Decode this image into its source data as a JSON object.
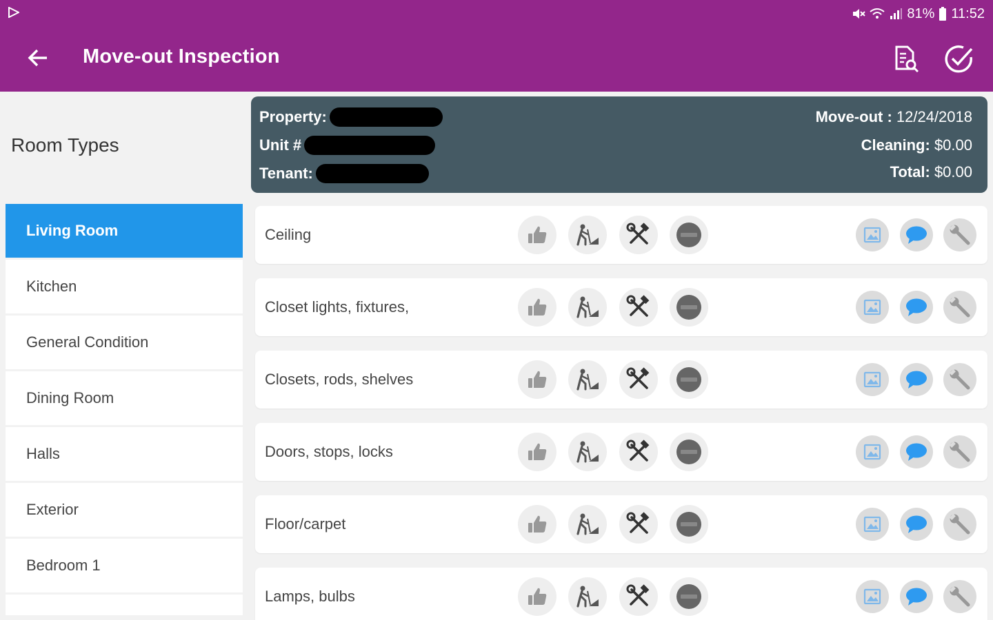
{
  "statusbar": {
    "battery": "81%",
    "time": "11:52"
  },
  "toolbar": {
    "title": "Move-out Inspection"
  },
  "sidebar": {
    "heading": "Room Types",
    "rooms": [
      "Living Room",
      "Kitchen",
      "General Condition",
      "Dining Room",
      "Halls",
      "Exterior",
      "Bedroom 1"
    ],
    "active_index": 0
  },
  "header": {
    "property_label": "Property:",
    "unit_label": "Unit #",
    "tenant_label": "Tenant:",
    "moveout_label": "Move-out :",
    "moveout_value": "12/24/2018",
    "cleaning_label": "Cleaning:",
    "cleaning_value": "$0.00",
    "total_label": "Total:",
    "total_value": "$0.00"
  },
  "items": [
    "Ceiling",
    "Closet lights, fixtures,",
    "Closets, rods, shelves",
    "Doors, stops, locks",
    "Floor/carpet",
    "Lamps, bulbs"
  ],
  "colors": {
    "appbar": "#93268b",
    "active_room": "#2196e9",
    "header_card": "#455a64",
    "comment_icon": "#2e9af0"
  }
}
